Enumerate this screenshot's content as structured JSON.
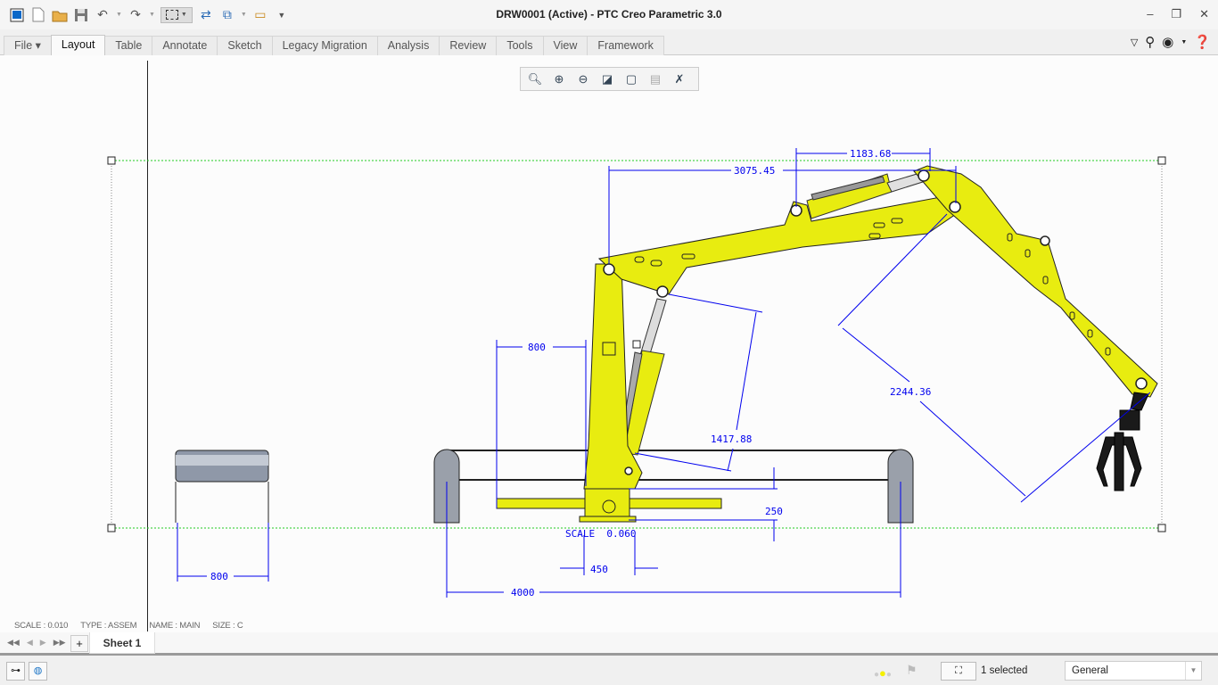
{
  "window": {
    "title": "DRW0001 (Active) - PTC Creo Parametric 3.0"
  },
  "quick_access": [
    "app-icon",
    "new-icon",
    "open-icon",
    "save-icon",
    "undo-icon",
    "redo-icon",
    "select-box-icon",
    "regenerate-icon",
    "windows-icon",
    "close-window-icon",
    "customize-icon"
  ],
  "ribbon": {
    "tabs": [
      {
        "label": "File ▾"
      },
      {
        "label": "Layout"
      },
      {
        "label": "Table"
      },
      {
        "label": "Annotate"
      },
      {
        "label": "Sketch"
      },
      {
        "label": "Legacy Migration"
      },
      {
        "label": "Analysis"
      },
      {
        "label": "Review"
      },
      {
        "label": "Tools"
      },
      {
        "label": "View"
      },
      {
        "label": "Framework"
      }
    ],
    "active": "Layout"
  },
  "view_toolbar": [
    "refit-icon",
    "zoom-in-icon",
    "zoom-out-icon",
    "repaint-icon",
    "display-style-icon",
    "sheet-icon",
    "annotation-display-icon"
  ],
  "drawing": {
    "dimensions": {
      "d1": "1183.68",
      "d2": "3075.45",
      "d3": "800",
      "d4": "2244.36",
      "d5": "1417.88",
      "d6": "250",
      "d7": "450",
      "d8": "4000",
      "d9": "800"
    },
    "scale_note": "SCALE  0.060",
    "colors": {
      "part": "#e8ec10",
      "dimension": "#0000ee",
      "frame": "#22cc22"
    }
  },
  "info": {
    "scale": "SCALE : 0.010",
    "type": "TYPE : ASSEM",
    "name": "NAME : MAIN",
    "size": "SIZE : C"
  },
  "sheets": {
    "tabs": [
      "Sheet 1"
    ],
    "add": "+"
  },
  "status": {
    "selected": "1 selected",
    "filter": "General"
  }
}
